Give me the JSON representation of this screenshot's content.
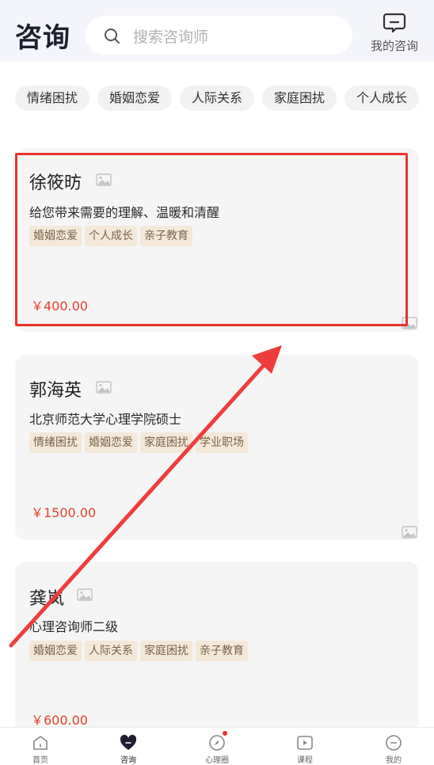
{
  "header": {
    "title": "咨询",
    "search_placeholder": "搜索咨询师",
    "my_consult_label": "我的咨询"
  },
  "categories": [
    "情绪困扰",
    "婚姻恋爱",
    "人际关系",
    "家庭困扰",
    "个人成长"
  ],
  "counselors": [
    {
      "name": "徐筱昉",
      "description": "给您带来需要的理解、温暖和清醒",
      "tags": [
        "婚姻恋爱",
        "个人成长",
        "亲子教育"
      ],
      "price": "￥400.00"
    },
    {
      "name": "郭海英",
      "description": "北京师范大学心理学院硕士",
      "tags": [
        "情绪困扰",
        "婚姻恋爱",
        "家庭困扰",
        "学业职场"
      ],
      "price": "￥1500.00"
    },
    {
      "name": "龚岚",
      "description": "心理咨询师二级",
      "tags": [
        "婚姻恋爱",
        "人际关系",
        "家庭困扰",
        "亲子教育"
      ],
      "price": "￥600.00"
    }
  ],
  "bottom_nav": [
    {
      "label": "首页",
      "icon": "home-icon",
      "active": false
    },
    {
      "label": "咨询",
      "icon": "heart-chat-icon",
      "active": true
    },
    {
      "label": "心理圈",
      "icon": "compass-icon",
      "active": false,
      "badge_dot": true
    },
    {
      "label": "课程",
      "icon": "play-icon",
      "active": false
    },
    {
      "label": "我的",
      "icon": "profile-icon",
      "active": false
    }
  ],
  "colors": {
    "header_bg": "#f4f5fa",
    "price": "#e5412d",
    "tag_bg": "#f4e8d8",
    "tag_text": "#7a6448",
    "highlight": "#e8332f"
  }
}
